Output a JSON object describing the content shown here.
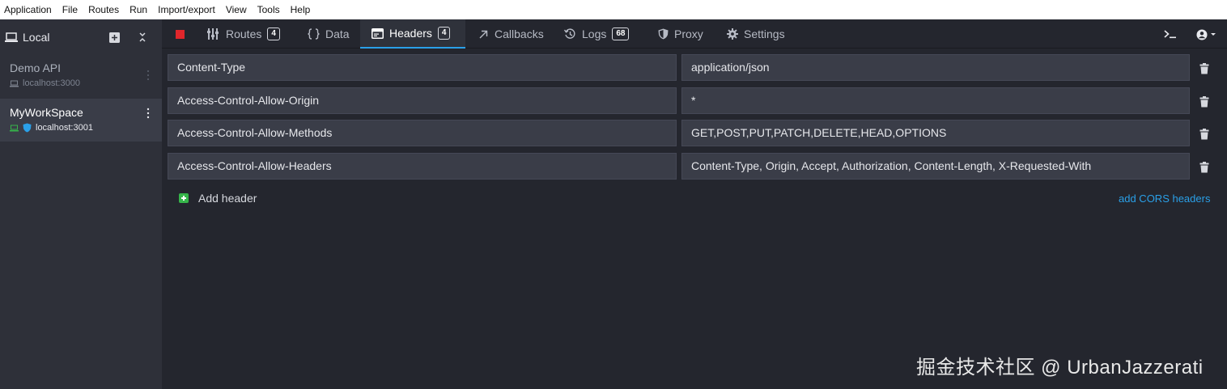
{
  "menu": [
    "Application",
    "File",
    "Routes",
    "Run",
    "Import/export",
    "View",
    "Tools",
    "Help"
  ],
  "sidebar": {
    "title": "Local",
    "environments": [
      {
        "name": "Demo API",
        "host": "localhost:3000",
        "active": false
      },
      {
        "name": "MyWorkSpace",
        "host": "localhost:3001",
        "active": true
      }
    ]
  },
  "tabs": [
    {
      "id": "routes",
      "label": "Routes",
      "badge": "4",
      "icon": "routes-icon"
    },
    {
      "id": "data",
      "label": "Data",
      "badge": null,
      "icon": "braces-icon"
    },
    {
      "id": "headers",
      "label": "Headers",
      "badge": "4",
      "icon": "window-icon",
      "active": true
    },
    {
      "id": "callbacks",
      "label": "Callbacks",
      "badge": null,
      "icon": "arrow-up-right-icon"
    },
    {
      "id": "logs",
      "label": "Logs",
      "badge": "68",
      "icon": "history-icon"
    },
    {
      "id": "proxy",
      "label": "Proxy",
      "badge": null,
      "icon": "shield-icon"
    },
    {
      "id": "settings",
      "label": "Settings",
      "badge": null,
      "icon": "gear-icon"
    }
  ],
  "headers": [
    {
      "key": "Content-Type",
      "value": "application/json"
    },
    {
      "key": "Access-Control-Allow-Origin",
      "value": "*"
    },
    {
      "key": "Access-Control-Allow-Methods",
      "value": "GET,POST,PUT,PATCH,DELETE,HEAD,OPTIONS"
    },
    {
      "key": "Access-Control-Allow-Headers",
      "value": "Content-Type, Origin, Accept, Authorization, Content-Length, X-Requested-With"
    }
  ],
  "actions": {
    "add_header": "Add header",
    "add_cors": "add CORS headers"
  },
  "colors": {
    "accent": "#2aa0e8",
    "stop": "#e0262b",
    "add": "#36b54a"
  },
  "watermark": "掘金技术社区 @ UrbanJazzerati"
}
